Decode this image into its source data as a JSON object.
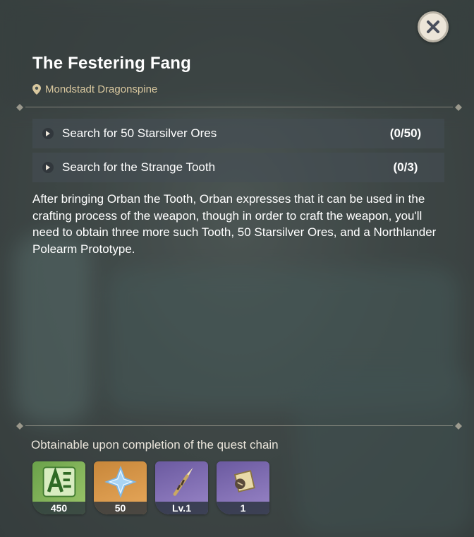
{
  "window": {
    "close_icon": "close-x-icon"
  },
  "quest": {
    "title": "The Festering Fang",
    "location_icon": "map-pin-icon",
    "location": "Mondstadt Dragonspine"
  },
  "objectives": [
    {
      "label": "Search for 50 Starsilver Ores",
      "progress": "(0/50)"
    },
    {
      "label": "Search for the Strange Tooth",
      "progress": "(0/3)"
    }
  ],
  "description": "After bringing Orban the Tooth, Orban expresses that it can be used in the crafting process of the weapon, though in order to craft the weapon, you'll need to obtain three more such Tooth, 50 Starsilver Ores, and a Northlander Polearm Prototype.",
  "rewards": {
    "label": "Obtainable upon completion of the quest chain",
    "items": [
      {
        "icon": "adventure-exp-icon",
        "quantity": "450"
      },
      {
        "icon": "primogem-icon",
        "quantity": "50"
      },
      {
        "icon": "polearm-icon",
        "quantity": "Lv.1"
      },
      {
        "icon": "crafting-material-icon",
        "quantity": "1"
      }
    ]
  },
  "colors": {
    "location": "#d9c89f",
    "text": "#ffffff",
    "panel": "#464e56"
  }
}
